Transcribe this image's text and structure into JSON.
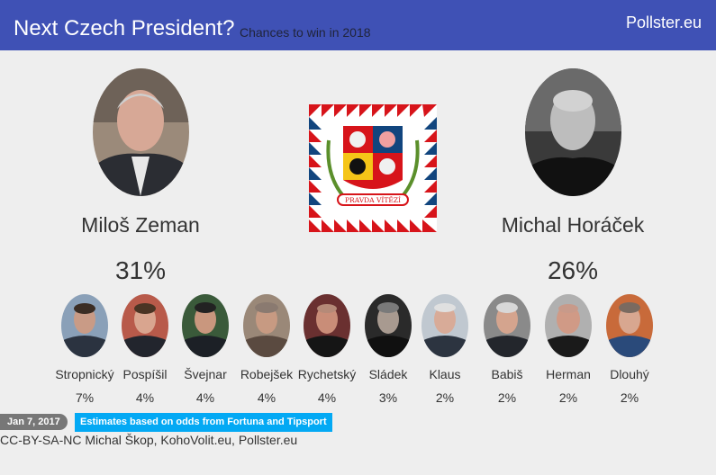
{
  "header": {
    "title": "Next Czech President?",
    "subtitle": "Chances to win in 2018",
    "brand": "Pollster.eu"
  },
  "colors": {
    "header_bg": "#3f51b5",
    "badge_date": "#777777",
    "badge_note": "#03a9f4"
  },
  "leaders": [
    {
      "name": "Miloš Zeman",
      "percent": "31%"
    },
    {
      "name": "Michal Horáček",
      "percent": "26%"
    }
  ],
  "candidates": [
    {
      "name": "Stropnický",
      "percent": "7%"
    },
    {
      "name": "Pospíšil",
      "percent": "4%"
    },
    {
      "name": "Švejnar",
      "percent": "4%"
    },
    {
      "name": "Robejšek",
      "percent": "4%"
    },
    {
      "name": "Rychetský",
      "percent": "4%"
    },
    {
      "name": "Sládek",
      "percent": "3%"
    },
    {
      "name": "Klaus",
      "percent": "2%"
    },
    {
      "name": "Babiš",
      "percent": "2%"
    },
    {
      "name": "Herman",
      "percent": "2%"
    },
    {
      "name": "Dlouhý",
      "percent": "2%"
    }
  ],
  "flag": {
    "motto": "PRAVDA VÍTĚZÍ"
  },
  "footer": {
    "date": "Jan 7, 2017",
    "note": "Estimates based on odds from Fortuna and Tipsport",
    "credits": "CC-BY-SA-NC Michal Škop, KohoVolit.eu, Pollster.eu"
  }
}
